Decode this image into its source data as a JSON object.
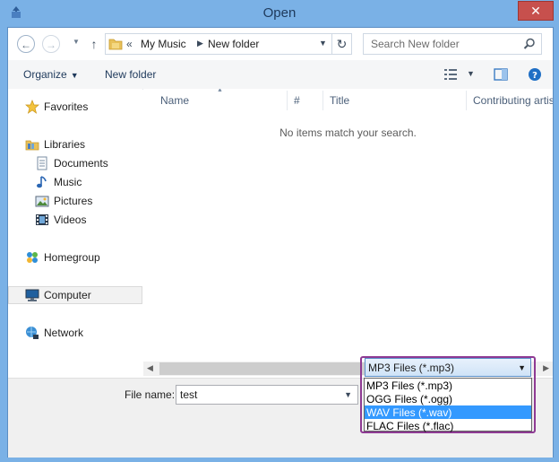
{
  "window": {
    "title": "Open",
    "close_glyph": "✕",
    "icon": "app-icon"
  },
  "nav": {
    "back_glyph": "←",
    "forward_glyph": "→",
    "up_glyph": "↑",
    "breadcrumb_chevron": "«",
    "path": [
      "My Music",
      "New folder"
    ],
    "refresh_glyph": "↻",
    "search_placeholder": "Search New folder"
  },
  "toolbar": {
    "organize_label": "Organize",
    "new_folder_label": "New folder"
  },
  "sidebar": {
    "items": [
      {
        "label": "Favorites",
        "icon": "star-icon"
      },
      {
        "label": "Libraries",
        "icon": "libraries-icon"
      },
      {
        "label": "Documents",
        "icon": "documents-icon"
      },
      {
        "label": "Music",
        "icon": "music-icon"
      },
      {
        "label": "Pictures",
        "icon": "pictures-icon"
      },
      {
        "label": "Videos",
        "icon": "videos-icon"
      },
      {
        "label": "Homegroup",
        "icon": "homegroup-icon"
      },
      {
        "label": "Computer",
        "icon": "computer-icon"
      },
      {
        "label": "Network",
        "icon": "network-icon"
      }
    ]
  },
  "columns": {
    "name": "Name",
    "number": "#",
    "title": "Title",
    "contributing": "Contributing artis"
  },
  "content": {
    "empty_message": "No items match your search."
  },
  "bottom": {
    "file_name_label": "File name:",
    "file_name_value": "test",
    "filter_selected": "MP3 Files (*.mp3)",
    "filter_options": [
      "MP3 Files (*.mp3)",
      "OGG Files (*.ogg)",
      "WAV Files (*.wav)",
      "FLAC Files (*.flac)"
    ],
    "highlighted_option": "WAV Files (*.wav)"
  },
  "colors": {
    "accent": "#3399ff",
    "frame": "#7ab1e6",
    "close": "#c7504d",
    "highlight_outline": "#8e3a93"
  }
}
